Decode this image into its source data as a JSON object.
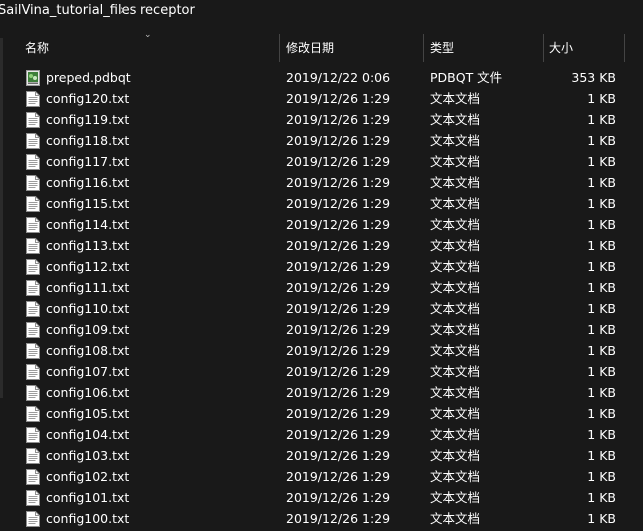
{
  "breadcrumb": {
    "parent": "SailVina_tutorial_files",
    "separator": "›",
    "current": "receptor"
  },
  "columns": {
    "name": "名称",
    "date": "修改日期",
    "type": "类型",
    "size": "大小"
  },
  "files": [
    {
      "name": "preped.pdbqt",
      "date": "2019/12/22 0:06",
      "type": "PDBQT 文件",
      "size": "353 KB",
      "icon": "pdbqt-file-icon"
    },
    {
      "name": "config120.txt",
      "date": "2019/12/26 1:29",
      "type": "文本文档",
      "size": "1 KB",
      "icon": "text-file-icon"
    },
    {
      "name": "config119.txt",
      "date": "2019/12/26 1:29",
      "type": "文本文档",
      "size": "1 KB",
      "icon": "text-file-icon"
    },
    {
      "name": "config118.txt",
      "date": "2019/12/26 1:29",
      "type": "文本文档",
      "size": "1 KB",
      "icon": "text-file-icon"
    },
    {
      "name": "config117.txt",
      "date": "2019/12/26 1:29",
      "type": "文本文档",
      "size": "1 KB",
      "icon": "text-file-icon"
    },
    {
      "name": "config116.txt",
      "date": "2019/12/26 1:29",
      "type": "文本文档",
      "size": "1 KB",
      "icon": "text-file-icon"
    },
    {
      "name": "config115.txt",
      "date": "2019/12/26 1:29",
      "type": "文本文档",
      "size": "1 KB",
      "icon": "text-file-icon"
    },
    {
      "name": "config114.txt",
      "date": "2019/12/26 1:29",
      "type": "文本文档",
      "size": "1 KB",
      "icon": "text-file-icon"
    },
    {
      "name": "config113.txt",
      "date": "2019/12/26 1:29",
      "type": "文本文档",
      "size": "1 KB",
      "icon": "text-file-icon"
    },
    {
      "name": "config112.txt",
      "date": "2019/12/26 1:29",
      "type": "文本文档",
      "size": "1 KB",
      "icon": "text-file-icon"
    },
    {
      "name": "config111.txt",
      "date": "2019/12/26 1:29",
      "type": "文本文档",
      "size": "1 KB",
      "icon": "text-file-icon"
    },
    {
      "name": "config110.txt",
      "date": "2019/12/26 1:29",
      "type": "文本文档",
      "size": "1 KB",
      "icon": "text-file-icon"
    },
    {
      "name": "config109.txt",
      "date": "2019/12/26 1:29",
      "type": "文本文档",
      "size": "1 KB",
      "icon": "text-file-icon"
    },
    {
      "name": "config108.txt",
      "date": "2019/12/26 1:29",
      "type": "文本文档",
      "size": "1 KB",
      "icon": "text-file-icon"
    },
    {
      "name": "config107.txt",
      "date": "2019/12/26 1:29",
      "type": "文本文档",
      "size": "1 KB",
      "icon": "text-file-icon"
    },
    {
      "name": "config106.txt",
      "date": "2019/12/26 1:29",
      "type": "文本文档",
      "size": "1 KB",
      "icon": "text-file-icon"
    },
    {
      "name": "config105.txt",
      "date": "2019/12/26 1:29",
      "type": "文本文档",
      "size": "1 KB",
      "icon": "text-file-icon"
    },
    {
      "name": "config104.txt",
      "date": "2019/12/26 1:29",
      "type": "文本文档",
      "size": "1 KB",
      "icon": "text-file-icon"
    },
    {
      "name": "config103.txt",
      "date": "2019/12/26 1:29",
      "type": "文本文档",
      "size": "1 KB",
      "icon": "text-file-icon"
    },
    {
      "name": "config102.txt",
      "date": "2019/12/26 1:29",
      "type": "文本文档",
      "size": "1 KB",
      "icon": "text-file-icon"
    },
    {
      "name": "config101.txt",
      "date": "2019/12/26 1:29",
      "type": "文本文档",
      "size": "1 KB",
      "icon": "text-file-icon"
    },
    {
      "name": "config100.txt",
      "date": "2019/12/26 1:29",
      "type": "文本文档",
      "size": "1 KB",
      "icon": "text-file-icon"
    }
  ],
  "colors": {
    "background": "#191919",
    "text": "#ffffff",
    "divider": "#444444"
  }
}
